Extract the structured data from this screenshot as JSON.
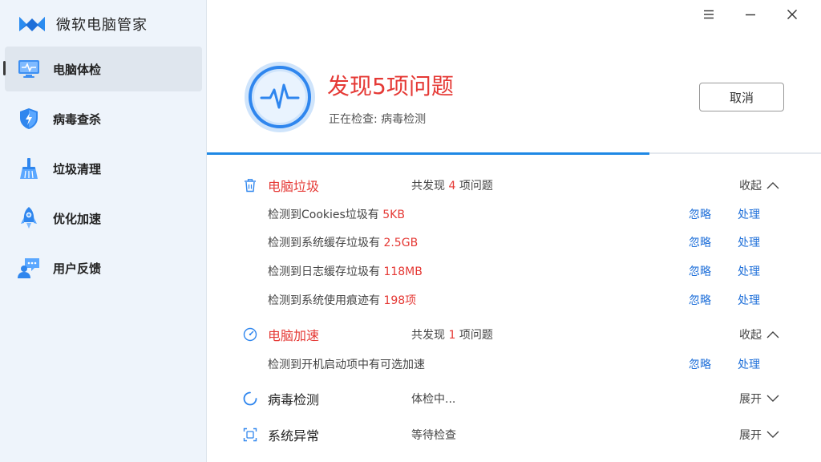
{
  "app": {
    "name": "微软电脑管家"
  },
  "sidebar": {
    "items": [
      {
        "label": "电脑体检",
        "icon": "monitor-icon",
        "active": true
      },
      {
        "label": "病毒查杀",
        "icon": "shield-icon",
        "active": false
      },
      {
        "label": "垃圾清理",
        "icon": "broom-icon",
        "active": false
      },
      {
        "label": "优化加速",
        "icon": "rocket-icon",
        "active": false
      },
      {
        "label": "用户反馈",
        "icon": "feedback-icon",
        "active": false
      }
    ]
  },
  "window_controls": [
    "menu-icon",
    "minimize-icon",
    "close-icon"
  ],
  "header": {
    "title": "发现5项问题",
    "subtitle": "正在检查: 病毒检测",
    "cancel_label": "取消",
    "progress": 0.72
  },
  "colors": {
    "accent": "#1e88e5",
    "alert": "#e53935",
    "link": "#1e6fd9",
    "sidebar_bg": "#eef4fb"
  },
  "categories": {
    "junk": {
      "title": "电脑垃圾",
      "summary_prefix": "共发现",
      "summary_count": "4",
      "summary_suffix": "项问题",
      "toggle": "收起",
      "items": [
        {
          "text": "检测到Cookies垃圾有",
          "value": "5KB",
          "ignore": "忽略",
          "fix": "处理"
        },
        {
          "text": "检测到系统缓存垃圾有",
          "value": "2.5GB",
          "ignore": "忽略",
          "fix": "处理"
        },
        {
          "text": "检测到日志缓存垃圾有",
          "value": "118MB",
          "ignore": "忽略",
          "fix": "处理"
        },
        {
          "text": "检测到系统使用痕迹有",
          "value": "198项",
          "ignore": "忽略",
          "fix": "处理"
        }
      ]
    },
    "speed": {
      "title": "电脑加速",
      "summary_prefix": "共发现",
      "summary_count": "1",
      "summary_suffix": "项问题",
      "toggle": "收起",
      "items": [
        {
          "text": "检测到开机启动项中有可选加速",
          "ignore": "忽略",
          "fix": "处理"
        }
      ]
    },
    "virus": {
      "title": "病毒检测",
      "status": "体检中...",
      "toggle": "展开"
    },
    "system": {
      "title": "系统异常",
      "status": "等待检查",
      "toggle": "展开"
    }
  }
}
